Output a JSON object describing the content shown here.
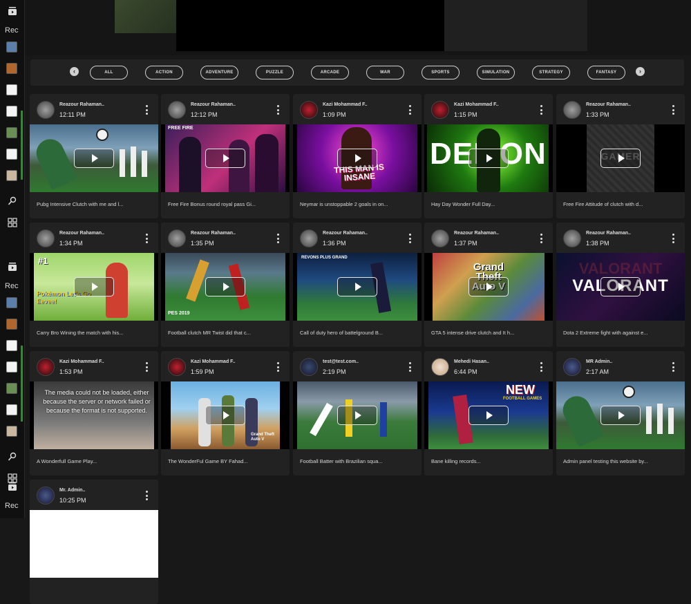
{
  "sidebar": {
    "labels": [
      "Rec",
      "Rec",
      "Rec"
    ]
  },
  "categories": [
    "ALL",
    "ACTION",
    "ADVENTURE",
    "PUZZLE",
    "ARCADE",
    "WAR",
    "SPORTS",
    "SIMULATION",
    "STRATEGY",
    "FANTASY"
  ],
  "cards": [
    {
      "user": "Reazour Rahaman..",
      "time": "12:11 PM",
      "title": "Pubg Intensive Clutch with me and l...",
      "art": "goalie"
    },
    {
      "user": "Reazour Rahaman..",
      "time": "12:12 PM",
      "title": "Free Fire Bonus round royal pass Gi...",
      "art": "freefire"
    },
    {
      "user": "Kazi Mohammad F..",
      "time": "1:09 PM",
      "title": "Neymar is unstoppable 2 goals in on...",
      "art": "insane"
    },
    {
      "user": "Kazi Mohammad F..",
      "time": "1:15 PM",
      "title": "Hay Day Wonder Full Day...",
      "art": "demon"
    },
    {
      "user": "Reazour Rahaman..",
      "time": "1:33 PM",
      "title": "Free Fire Attitude of clutch with d...",
      "art": "gamer"
    },
    {
      "user": "Reazour Rahaman..",
      "time": "1:34 PM",
      "title": "Carry Bro Wining the match with his...",
      "art": "pokemon"
    },
    {
      "user": "Reazour Rahaman..",
      "time": "1:35 PM",
      "title": "Football clutch MR Twist did that c...",
      "art": "pes"
    },
    {
      "user": "Reazour Rahaman..",
      "time": "1:36 PM",
      "title": "Call of duty hero of battelground B...",
      "art": "fifa"
    },
    {
      "user": "Reazour Rahaman..",
      "time": "1:37 PM",
      "title": "GTA 5 intense drive clutch and It h...",
      "art": "gta"
    },
    {
      "user": "Reazour Rahaman..",
      "time": "1:38 PM",
      "title": "Dota 2 Extreme fight with against e...",
      "art": "valorant"
    },
    {
      "user": "Kazi Mohammad F..",
      "time": "1:53 PM",
      "title": "A Wonderfull Game Play...",
      "art": "error",
      "error_text": "The media could not be loaded, either because the server or network failed or because the format is not supported."
    },
    {
      "user": "Kazi Mohammad F..",
      "time": "1:59 PM",
      "title": "The WonderFul Game BY Fahad...",
      "art": "gta5"
    },
    {
      "user": "test@test.com..",
      "time": "2:19 PM",
      "title": "Football Batter with Brazilian squa...",
      "art": "football"
    },
    {
      "user": "Mehedi Hasan..",
      "time": "6:44 PM",
      "title": "Bane killing records...",
      "art": "newgames"
    },
    {
      "user": "MR Admin..",
      "time": "2:17 AM",
      "title": "Admin panel testing this website by...",
      "art": "goalie"
    },
    {
      "user": "Mr. Admin..",
      "time": "10:25 PM",
      "title": "",
      "art": "blank"
    }
  ],
  "art_texts": {
    "freefire": "FREE FIRE",
    "insane": "THIS MAN IS INSANE",
    "demon": "DEMON",
    "gamer": "GAMER",
    "pokemon_num": "#1",
    "pokemon": "Pokémon Let's Go Eevee!",
    "pes": "PES 2019",
    "fifa": "REVONS PLUS GRAND",
    "gta": "Grand Theft Auto V",
    "valorant": "VALORANT",
    "newgames_new": "NEW",
    "newgames_sub": "FOOTBALL GAMES",
    "gta5": "Grand Theft Auto V"
  }
}
